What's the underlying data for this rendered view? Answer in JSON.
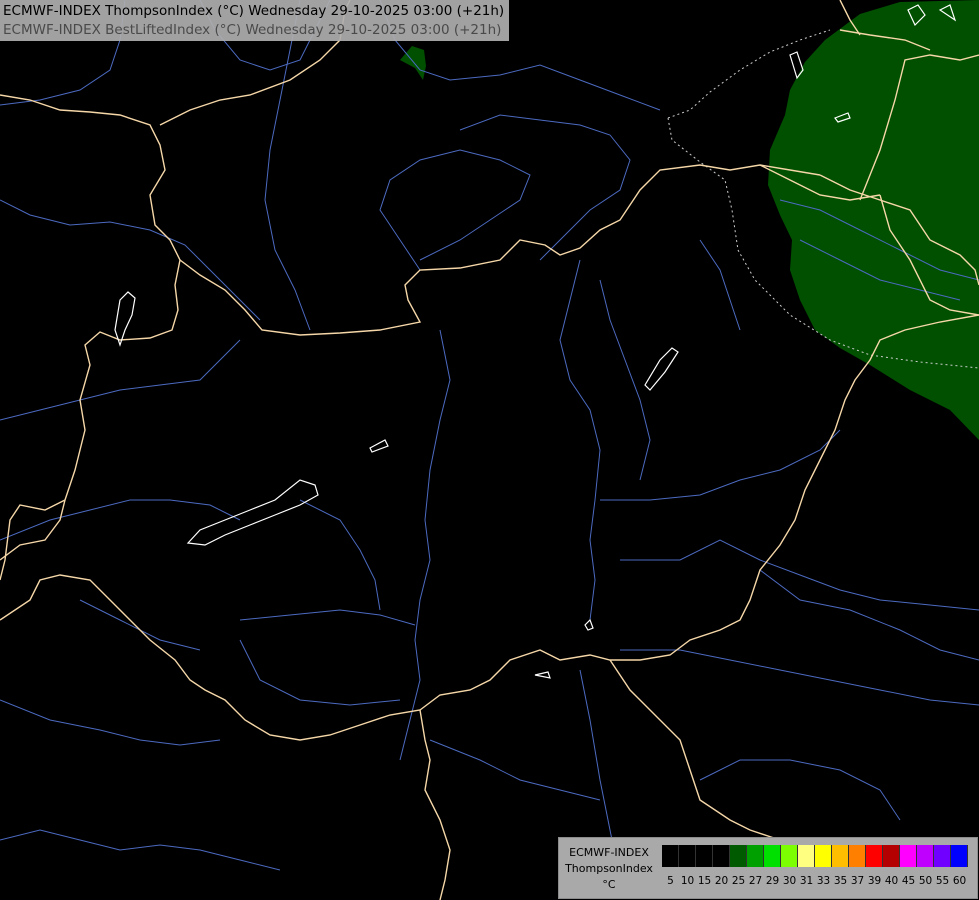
{
  "header": {
    "line1": "ECMWF-INDEX ThompsonIndex (°C) Wednesday 29-10-2025 03:00 (+21h)",
    "line2": "ECMWF-INDEX BestLiftedIndex (°C) Wednesday 29-10-2025 03:00 (+21h)"
  },
  "legend": {
    "title1": "ECMWF-INDEX",
    "title2": "ThompsonIndex",
    "unit": "°C",
    "levels": [
      "5",
      "10",
      "15",
      "20",
      "25",
      "27",
      "29",
      "30",
      "31",
      "33",
      "35",
      "37",
      "39",
      "40",
      "45",
      "50",
      "55",
      "60"
    ],
    "colors": [
      "#000000",
      "#000000",
      "#000000",
      "#000000",
      "#005a00",
      "#00a000",
      "#00e000",
      "#7cff00",
      "#ffff80",
      "#ffff00",
      "#ffbf00",
      "#ff8000",
      "#ff0000",
      "#b40000",
      "#ff00ff",
      "#c000ff",
      "#7000ff",
      "#0000ff"
    ]
  },
  "map": {
    "background": "#000000",
    "border_color": "#f5d7a8",
    "river_color": "#4c6ac0",
    "lake_color": "#ffffff",
    "green_area_color": "#005000"
  }
}
